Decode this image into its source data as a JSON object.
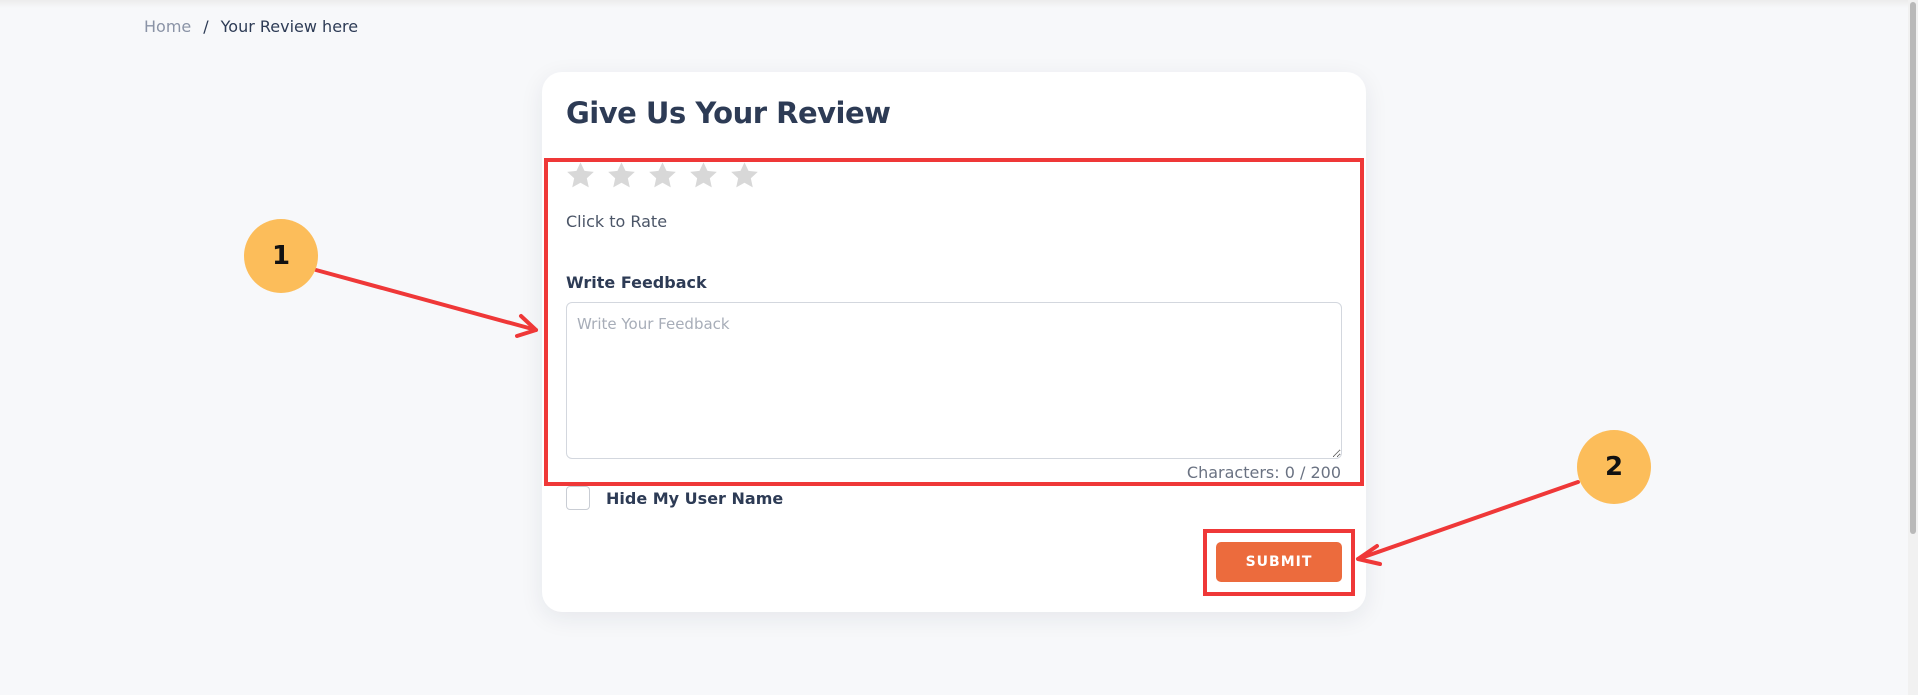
{
  "breadcrumb": {
    "home": "Home",
    "separator": "/",
    "current": "Your Review here"
  },
  "review_form": {
    "title": "Give Us Your Review",
    "rating": {
      "max_stars": 5,
      "selected": 0,
      "star_icon": "star-icon",
      "empty_color": "#d8d8d8",
      "hint": "Click to Rate"
    },
    "feedback": {
      "label": "Write Feedback",
      "placeholder": "Write Your Feedback",
      "value": "",
      "char_count": "Characters: 0 / 200"
    },
    "hide_username": {
      "label": "Hide My User Name",
      "checked": false
    },
    "submit_label": "SUBMIT"
  },
  "annotations": {
    "marker_1": "1",
    "marker_2": "2",
    "highlight_color": "#ef3838",
    "marker_color": "#fcbd5a"
  },
  "colors": {
    "accent": "#ec6b3d",
    "text_dark": "#2d3b55",
    "background": "#f7f8fa"
  }
}
